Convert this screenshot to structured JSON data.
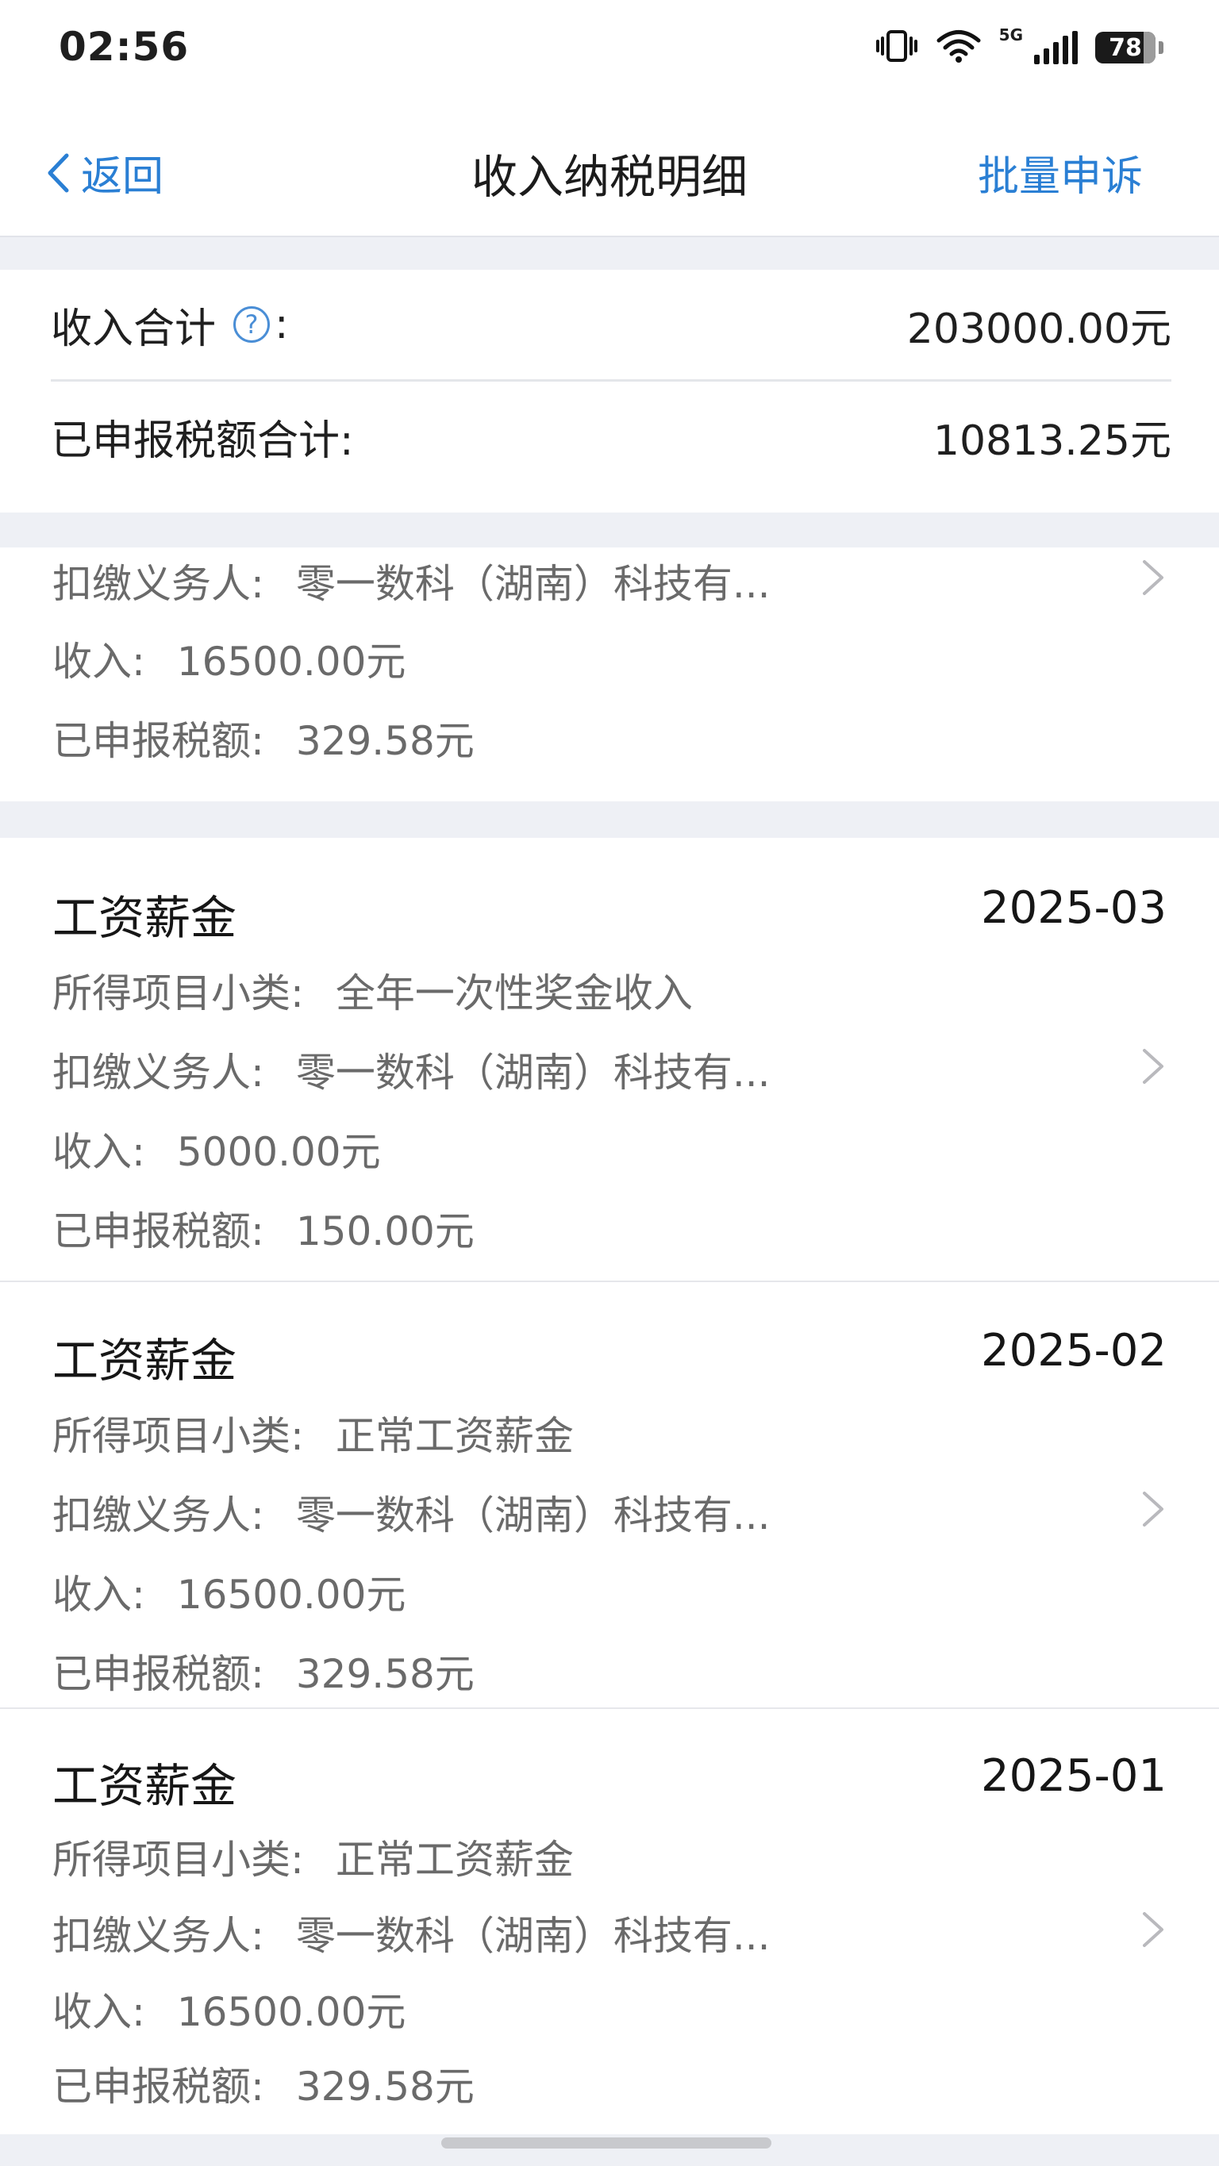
{
  "status_bar": {
    "time": "02:56",
    "network": "5G",
    "battery": "78"
  },
  "nav": {
    "back_label": "返回",
    "title": "收入纳税明细",
    "action_label": "批量申诉"
  },
  "summary": {
    "income_total_label": "收入合计",
    "income_total_colon": ":",
    "income_total_value": "203000.00元",
    "tax_total_label": "已申报税额合计:",
    "tax_total_value": "10813.25元"
  },
  "labels": {
    "subcategory": "所得项目小类:",
    "withholder": "扣缴义务人:",
    "income": "收入:",
    "tax": "已申报税额:"
  },
  "records": [
    {
      "withholder": "零一数科（湖南）科技有...",
      "income": "16500.00元",
      "tax": "329.58元"
    },
    {
      "title": "工资薪金",
      "date": "2025-03",
      "subcategory": "全年一次性奖金收入",
      "withholder": "零一数科（湖南）科技有...",
      "income": "5000.00元",
      "tax": "150.00元"
    },
    {
      "title": "工资薪金",
      "date": "2025-02",
      "subcategory": "正常工资薪金",
      "withholder": "零一数科（湖南）科技有...",
      "income": "16500.00元",
      "tax": "329.58元"
    },
    {
      "title": "工资薪金",
      "date": "2025-01",
      "subcategory": "正常工资薪金",
      "withholder": "零一数科（湖南）科技有...",
      "income": "16500.00元",
      "tax": "329.58元"
    }
  ],
  "colors": {
    "accent": "#2a7fd4",
    "background": "#eef0f5"
  }
}
